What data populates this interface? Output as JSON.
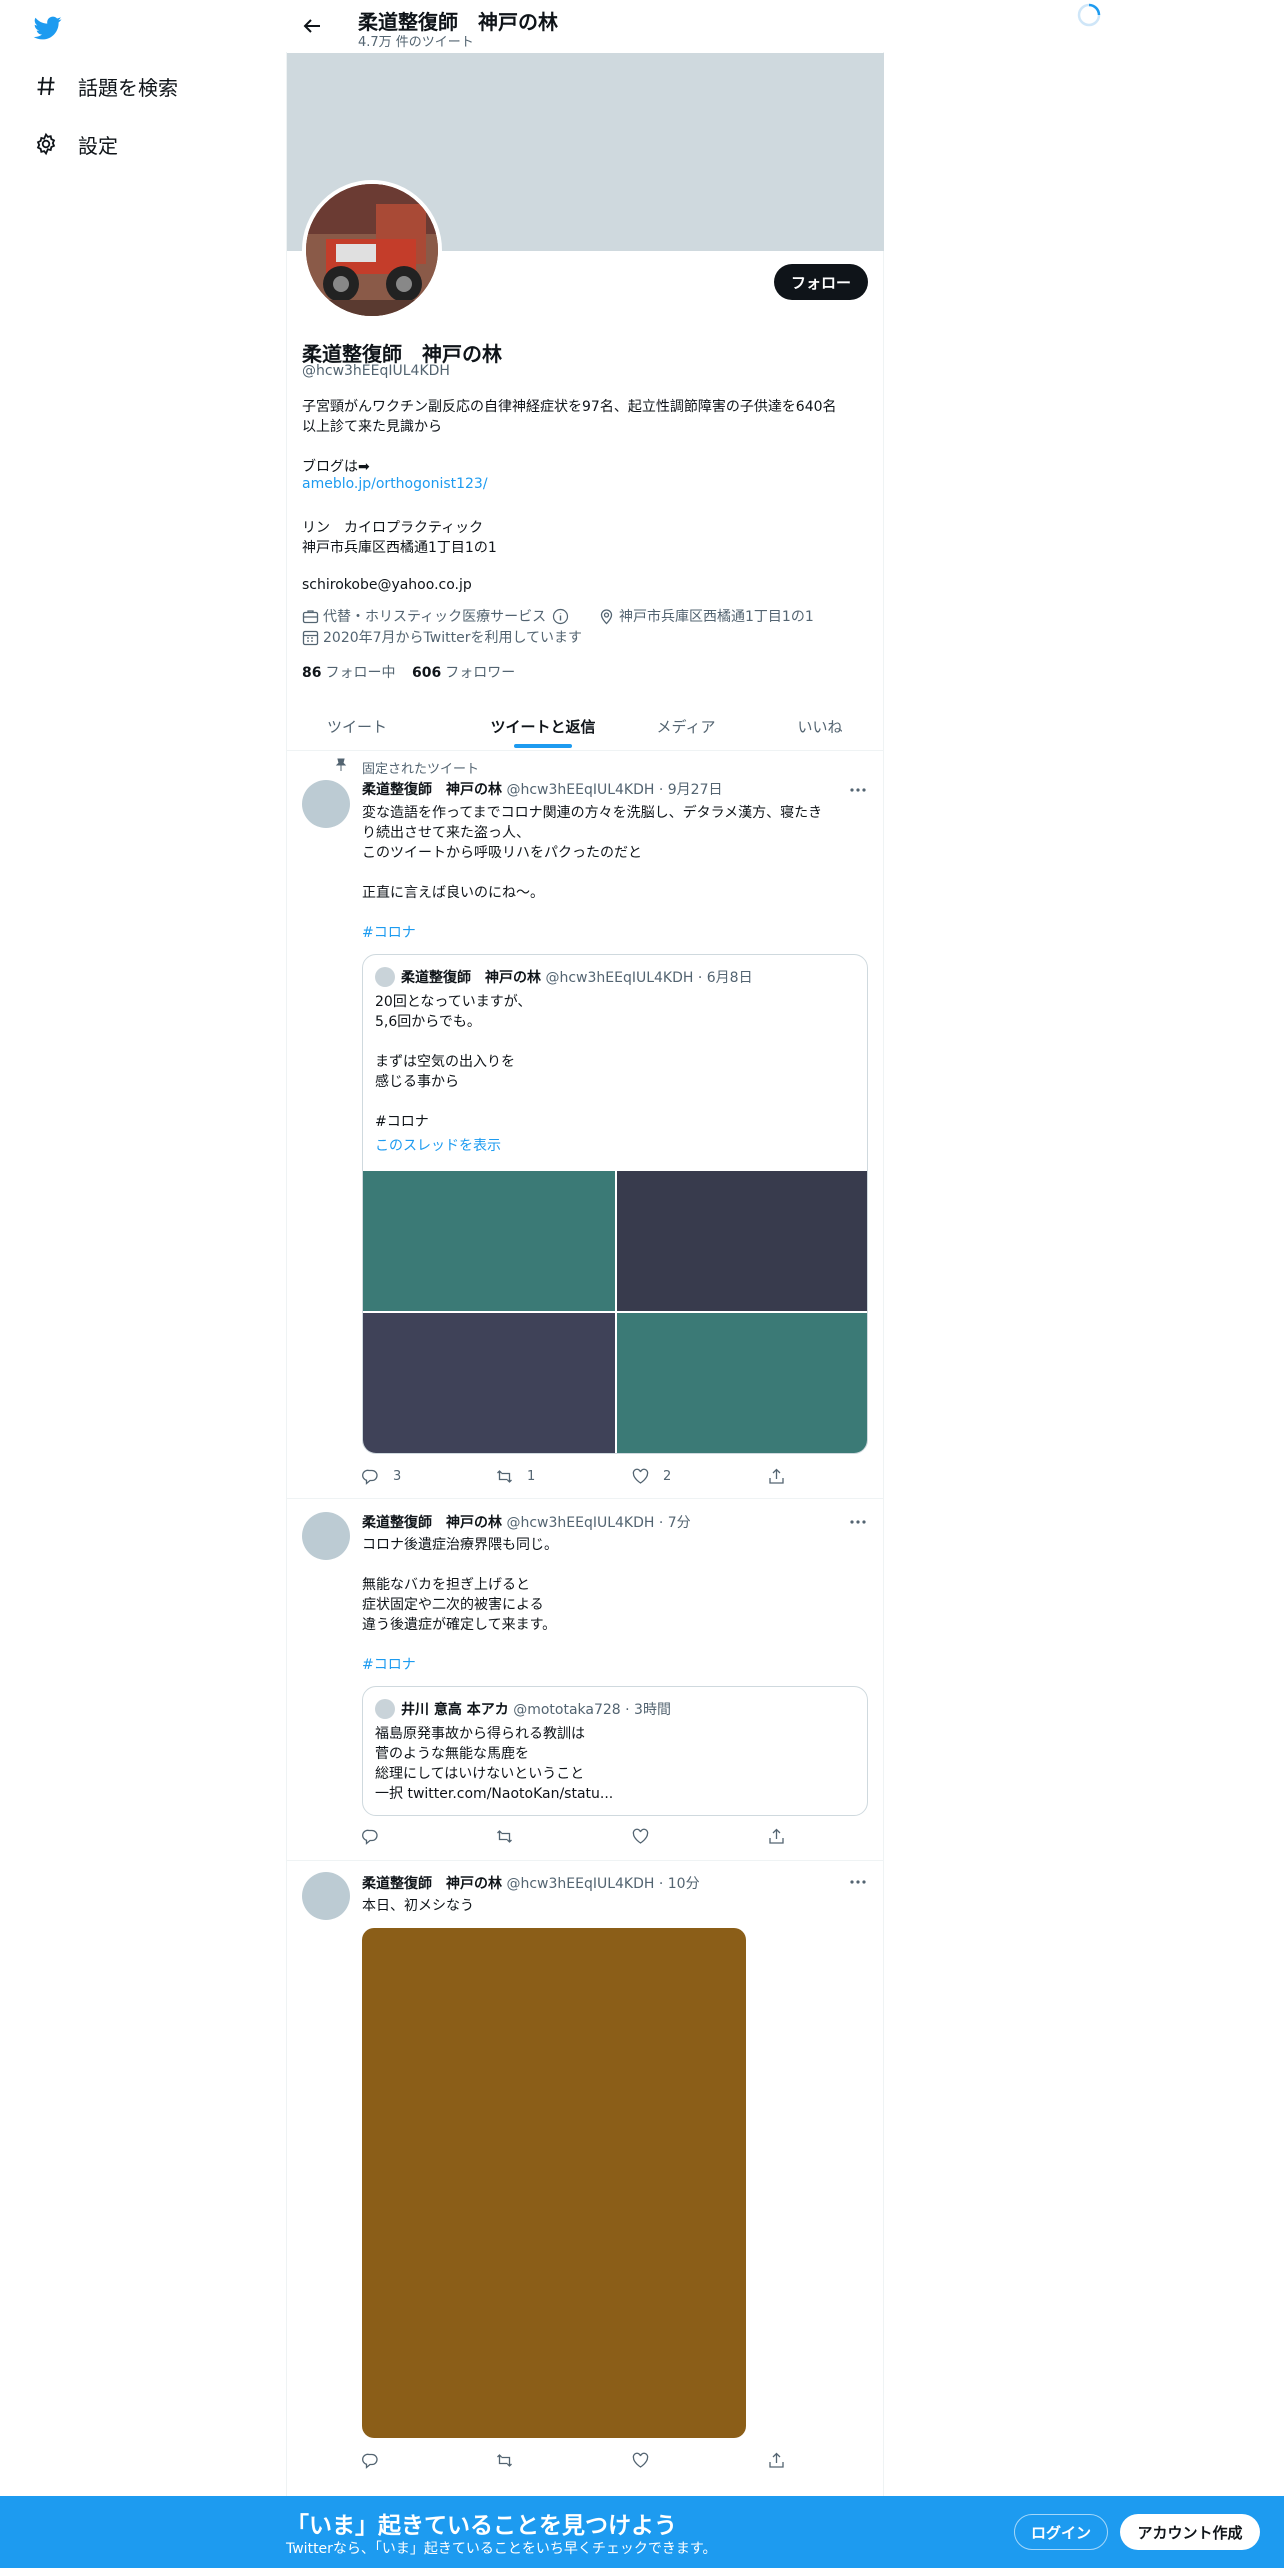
{
  "nav": {
    "items": [
      {
        "label": "話題を検索",
        "icon": "hashtag-icon"
      },
      {
        "label": "設定",
        "icon": "gear-icon"
      }
    ]
  },
  "header": {
    "name": "柔道整復師　神戸の林",
    "tweet_count": "4.7万 件のツイート"
  },
  "profile": {
    "name": "柔道整復師　神戸の林",
    "handle": "@hcw3hEEqIUL4KDH",
    "follow_label": "フォロー",
    "bio": [
      "子宮頸がんワクチン副反応の自律神経症状を97名、起立性調節障害の子供達を640名",
      "以上診て来た見識から",
      "ブログは➡",
      "ameblo.jp/orthogonist123/",
      "リン　カイロプラクティック",
      "神戸市兵庫区西橘通1丁目1の1",
      "schirokobe@yahoo.co.jp"
    ],
    "category": "代替・ホリスティック医療サービス",
    "location": "神戸市兵庫区西橘通1丁目1の1",
    "joined": "2020年7月からTwitterを利用しています",
    "following_count": "86",
    "following_label": "フォロー中",
    "followers_count": "606",
    "followers_label": "フォロワー"
  },
  "tabs": [
    {
      "label": "ツイート"
    },
    {
      "label": "ツイートと返信"
    },
    {
      "label": "メディア"
    },
    {
      "label": "いいね"
    }
  ],
  "tweets": [
    {
      "pinned_label": "固定されたツイート",
      "name": "柔道整復師　神戸の林",
      "handle_time": "@hcw3hEEqIUL4KDH · 9月27日",
      "lines": [
        "変な造語を作ってまでコロナ関連の方々を洗脳し、デタラメ漢方、寝たき",
        "り続出させて来た盗っ人、",
        "このツイートから呼吸リハをパクったのだと",
        "正直に言えば良いのにね〜。"
      ],
      "hashtag": "#コロナ",
      "quote": {
        "name": "柔道整復師　神戸の林",
        "handle_time": "@hcw3hEEqIUL4KDH · 6月8日",
        "lines": [
          "20回となっていますが、",
          "5,6回からでも。",
          "まずは空気の出入りを",
          "感じる事から",
          "#コロナ"
        ],
        "thread_link": "このスレッドを表示",
        "images": [
          "#3b7a76",
          "#383b4d",
          "#3f4258",
          "#3b7a76"
        ]
      },
      "replies": "3",
      "retweets": "1",
      "likes": "2"
    },
    {
      "name": "柔道整復師　神戸の林",
      "handle_time": "@hcw3hEEqIUL4KDH · 7分",
      "lines": [
        "コロナ後遺症治療界隈も同じ。",
        "無能なバカを担ぎ上げると",
        "症状固定や二次的被害による",
        "違う後遺症が確定して来ます。"
      ],
      "hashtag": "#コロナ",
      "quote": {
        "name": "井川 意高 本アカ",
        "handle_time": "@mototaka728 · 3時間",
        "lines": [
          "福島原発事故から得られる教訓は",
          "菅のような無能な馬鹿を",
          "総理にしてはいけないということ",
          "一択 twitter.com/NaotoKan/statu..."
        ]
      }
    },
    {
      "name": "柔道整復師　神戸の林",
      "handle_time": "@hcw3hEEqIUL4KDH · 10分",
      "lines": [
        "本日、初メシなう"
      ],
      "image_color": "#8b5e18"
    }
  ],
  "bottom_bar": {
    "title": "「いま」起きていることを見つけよう",
    "subtitle": "Twitterなら、「いま」起きていることをいち早くチェックできます。",
    "login_label": "ログイン",
    "signup_label": "アカウント作成"
  },
  "colors": {
    "accent": "#1d9bf0",
    "banner": "#cfd9de"
  }
}
